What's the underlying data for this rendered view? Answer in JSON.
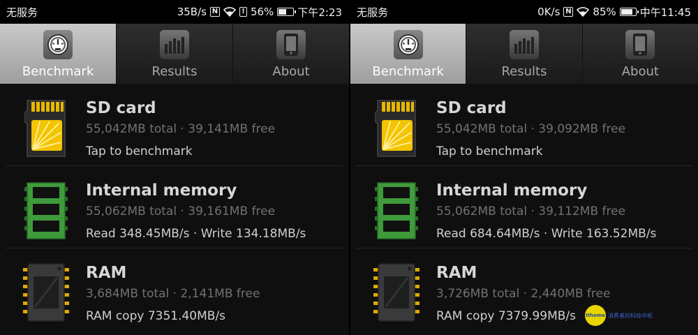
{
  "screens": [
    {
      "status": {
        "carrier": "无服务",
        "speed": "35B/s",
        "battery": "56%",
        "battery_level": 0.56,
        "time": "下午2:23"
      },
      "tabs": [
        {
          "label": "Benchmark",
          "icon": "speedometer-icon",
          "active": true
        },
        {
          "label": "Results",
          "icon": "bar-chart-icon",
          "active": false
        },
        {
          "label": "About",
          "icon": "phone-icon",
          "active": false
        }
      ],
      "items": [
        {
          "icon": "sd-card-icon",
          "name": "SD card",
          "info": "55,042MB total · 39,141MB free",
          "result": "Tap to benchmark"
        },
        {
          "icon": "memory-chip-icon",
          "name": "Internal memory",
          "info": "55,062MB total · 39,161MB free",
          "result": "Read 348.45MB/s · Write 134.18MB/s"
        },
        {
          "icon": "ram-chip-icon",
          "name": "RAM",
          "info": "3,684MB total · 2,141MB free",
          "result": "RAM copy 7351.40MB/s"
        }
      ]
    },
    {
      "status": {
        "carrier": "无服务",
        "speed": "0K/s",
        "battery": "85%",
        "battery_level": 0.85,
        "time": "中午11:45"
      },
      "tabs": [
        {
          "label": "Benchmark",
          "icon": "speedometer-icon",
          "active": true
        },
        {
          "label": "Results",
          "icon": "bar-chart-icon",
          "active": false
        },
        {
          "label": "About",
          "icon": "phone-icon",
          "active": false
        }
      ],
      "items": [
        {
          "icon": "sd-card-icon",
          "name": "SD card",
          "info": "55,042MB total · 39,092MB free",
          "result": "Tap to benchmark"
        },
        {
          "icon": "memory-chip-icon",
          "name": "Internal memory",
          "info": "55,062MB total · 39,112MB free",
          "result": "Read 684.64MB/s · Write 163.52MB/s"
        },
        {
          "icon": "ram-chip-icon",
          "name": "RAM",
          "info": "3,726MB total · 2,440MB free",
          "result": "RAM copy 7379.99MB/s"
        }
      ]
    }
  ],
  "watermark": {
    "badge": "Ithome",
    "text": "消费者的科技中枢"
  },
  "colors": {
    "accent_yellow": "#f2c200",
    "chip_green": "#2e8b3a",
    "tab_active": "#b5b5b5"
  }
}
